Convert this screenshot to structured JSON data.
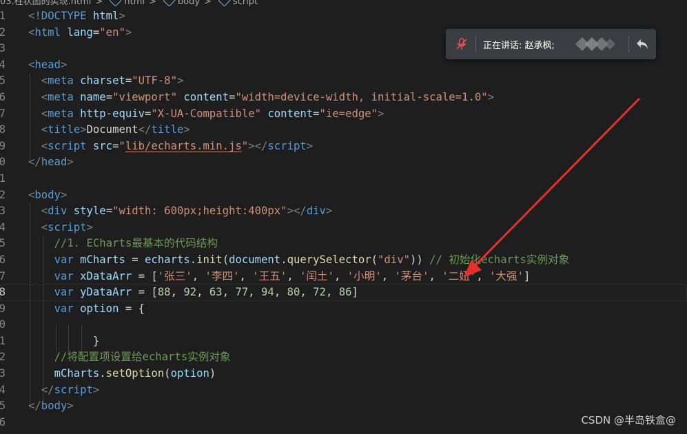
{
  "breadcrumb": {
    "file": "03.柱状图的实现.html",
    "items": [
      "html",
      "body",
      "script"
    ],
    "separator": ">"
  },
  "popup": {
    "speaking_label": "正在讲话: 赵承枫;",
    "mic_icon": "muted-mic-icon",
    "reply_icon": "reply-arrow-icon"
  },
  "watermark": "CSDN @半岛铁盒@",
  "annotation": {
    "color": "#e8302a",
    "shape": "red-arrow"
  },
  "editor": {
    "active_line": 18,
    "lines": [
      {
        "n": "1",
        "tokens": [
          [
            "pun",
            "<"
          ],
          [
            "tag",
            "!DOCTYPE"
          ],
          [
            "txt",
            " "
          ],
          [
            "attr",
            "html"
          ],
          [
            "pun",
            ">"
          ]
        ]
      },
      {
        "n": "2",
        "tokens": [
          [
            "pun",
            "<"
          ],
          [
            "tag",
            "html"
          ],
          [
            "txt",
            " "
          ],
          [
            "attr",
            "lang"
          ],
          [
            "txt",
            "="
          ],
          [
            "str",
            "\"en\""
          ],
          [
            "pun",
            ">"
          ]
        ]
      },
      {
        "n": "3",
        "tokens": []
      },
      {
        "n": "4",
        "tokens": [
          [
            "pun",
            "<"
          ],
          [
            "tag",
            "head"
          ],
          [
            "pun",
            ">"
          ]
        ]
      },
      {
        "n": "5",
        "tokens": [
          [
            "txt",
            "  "
          ],
          [
            "pun",
            "<"
          ],
          [
            "tag",
            "meta"
          ],
          [
            "txt",
            " "
          ],
          [
            "attr",
            "charset"
          ],
          [
            "txt",
            "="
          ],
          [
            "str",
            "\"UTF-8\""
          ],
          [
            "pun",
            ">"
          ]
        ]
      },
      {
        "n": "6",
        "tokens": [
          [
            "txt",
            "  "
          ],
          [
            "pun",
            "<"
          ],
          [
            "tag",
            "meta"
          ],
          [
            "txt",
            " "
          ],
          [
            "attr",
            "name"
          ],
          [
            "txt",
            "="
          ],
          [
            "str",
            "\"viewport\""
          ],
          [
            "txt",
            " "
          ],
          [
            "attr",
            "content"
          ],
          [
            "txt",
            "="
          ],
          [
            "str",
            "\"width=device-width, initial-scale=1.0\""
          ],
          [
            "pun",
            ">"
          ]
        ]
      },
      {
        "n": "7",
        "tokens": [
          [
            "txt",
            "  "
          ],
          [
            "pun",
            "<"
          ],
          [
            "tag",
            "meta"
          ],
          [
            "txt",
            " "
          ],
          [
            "attr",
            "http-equiv"
          ],
          [
            "txt",
            "="
          ],
          [
            "str",
            "\"X-UA-Compatible\""
          ],
          [
            "txt",
            " "
          ],
          [
            "attr",
            "content"
          ],
          [
            "txt",
            "="
          ],
          [
            "str",
            "\"ie=edge\""
          ],
          [
            "pun",
            ">"
          ]
        ]
      },
      {
        "n": "8",
        "tokens": [
          [
            "txt",
            "  "
          ],
          [
            "pun",
            "<"
          ],
          [
            "tag",
            "title"
          ],
          [
            "pun",
            ">"
          ],
          [
            "txt",
            "Document"
          ],
          [
            "pun",
            "</"
          ],
          [
            "tag",
            "title"
          ],
          [
            "pun",
            ">"
          ]
        ]
      },
      {
        "n": "9",
        "tokens": [
          [
            "txt",
            "  "
          ],
          [
            "pun",
            "<"
          ],
          [
            "tag",
            "script"
          ],
          [
            "txt",
            " "
          ],
          [
            "attr",
            "src"
          ],
          [
            "txt",
            "="
          ],
          [
            "str",
            "\""
          ],
          [
            "str ul",
            "lib/echarts.min.js"
          ],
          [
            "str",
            "\""
          ],
          [
            "pun",
            "></"
          ],
          [
            "tag",
            "script"
          ],
          [
            "pun",
            ">"
          ]
        ]
      },
      {
        "n": "0",
        "tokens": [
          [
            "pun",
            "</"
          ],
          [
            "tag",
            "head"
          ],
          [
            "pun",
            ">"
          ]
        ]
      },
      {
        "n": "1",
        "tokens": []
      },
      {
        "n": "2",
        "tokens": [
          [
            "pun",
            "<"
          ],
          [
            "tag",
            "body"
          ],
          [
            "pun",
            ">"
          ]
        ]
      },
      {
        "n": "3",
        "tokens": [
          [
            "txt",
            "  "
          ],
          [
            "pun",
            "<"
          ],
          [
            "tag",
            "div"
          ],
          [
            "txt",
            " "
          ],
          [
            "attr",
            "style"
          ],
          [
            "txt",
            "="
          ],
          [
            "str",
            "\"width: 600px;height:400px\""
          ],
          [
            "pun",
            "></"
          ],
          [
            "tag",
            "div"
          ],
          [
            "pun",
            ">"
          ]
        ]
      },
      {
        "n": "4",
        "tokens": [
          [
            "txt",
            "  "
          ],
          [
            "pun",
            "<"
          ],
          [
            "tag",
            "script"
          ],
          [
            "pun",
            ">"
          ]
        ]
      },
      {
        "n": "5",
        "tokens": [
          [
            "txt",
            "    "
          ],
          [
            "cmt",
            "//1. ECharts最基本的代码结构"
          ]
        ]
      },
      {
        "n": "6",
        "tokens": [
          [
            "txt",
            "    "
          ],
          [
            "kw",
            "var"
          ],
          [
            "txt",
            " "
          ],
          [
            "var",
            "mCharts"
          ],
          [
            "txt",
            " = "
          ],
          [
            "var",
            "echarts"
          ],
          [
            "txt",
            "."
          ],
          [
            "fn",
            "init"
          ],
          [
            "txt",
            "("
          ],
          [
            "var",
            "document"
          ],
          [
            "txt",
            "."
          ],
          [
            "fn",
            "querySelector"
          ],
          [
            "txt",
            "("
          ],
          [
            "str",
            "\"div\""
          ],
          [
            "txt",
            "))"
          ],
          [
            "txt",
            " "
          ],
          [
            "cmt",
            "// 初始化echarts实例对象"
          ]
        ]
      },
      {
        "n": "7",
        "tokens": [
          [
            "txt",
            "    "
          ],
          [
            "kw",
            "var"
          ],
          [
            "txt",
            " "
          ],
          [
            "var",
            "xDataArr"
          ],
          [
            "txt",
            " = ["
          ],
          [
            "str",
            "'张三'"
          ],
          [
            "txt",
            ", "
          ],
          [
            "str",
            "'李四'"
          ],
          [
            "txt",
            ", "
          ],
          [
            "str",
            "'王五'"
          ],
          [
            "txt",
            ", "
          ],
          [
            "str",
            "'闰土'"
          ],
          [
            "txt",
            ", "
          ],
          [
            "str",
            "'小明'"
          ],
          [
            "txt",
            ", "
          ],
          [
            "str",
            "'茅台'"
          ],
          [
            "txt",
            ", "
          ],
          [
            "str",
            "'二妞'"
          ],
          [
            "txt",
            ", "
          ],
          [
            "str",
            "'大强'"
          ],
          [
            "txt",
            "]"
          ]
        ]
      },
      {
        "n": "8",
        "tokens": [
          [
            "txt",
            "    "
          ],
          [
            "kw",
            "var"
          ],
          [
            "txt",
            " "
          ],
          [
            "var",
            "yDataArr"
          ],
          [
            "txt",
            " = ["
          ],
          [
            "num",
            "88"
          ],
          [
            "txt",
            ", "
          ],
          [
            "num",
            "92"
          ],
          [
            "txt",
            ", "
          ],
          [
            "num",
            "63"
          ],
          [
            "txt",
            ", "
          ],
          [
            "num",
            "77"
          ],
          [
            "txt",
            ", "
          ],
          [
            "num",
            "94"
          ],
          [
            "txt",
            ", "
          ],
          [
            "num",
            "80"
          ],
          [
            "txt",
            ", "
          ],
          [
            "num",
            "72"
          ],
          [
            "txt",
            ", "
          ],
          [
            "num",
            "86"
          ],
          [
            "txt",
            "]"
          ]
        ]
      },
      {
        "n": "9",
        "tokens": [
          [
            "txt",
            "    "
          ],
          [
            "kw",
            "var"
          ],
          [
            "txt",
            " "
          ],
          [
            "var",
            "option"
          ],
          [
            "txt",
            " = {"
          ]
        ]
      },
      {
        "n": "0",
        "tokens": []
      },
      {
        "n": "1",
        "tokens": [
          [
            "txt",
            "          }"
          ]
        ]
      },
      {
        "n": "2",
        "tokens": [
          [
            "txt",
            "    "
          ],
          [
            "cmt",
            "//将配置项设置给echarts实例对象"
          ]
        ]
      },
      {
        "n": "3",
        "tokens": [
          [
            "txt",
            "    "
          ],
          [
            "var",
            "mCharts"
          ],
          [
            "txt",
            "."
          ],
          [
            "fn",
            "setOption"
          ],
          [
            "txt",
            "("
          ],
          [
            "var",
            "option"
          ],
          [
            "txt",
            ")"
          ]
        ]
      },
      {
        "n": "4",
        "tokens": [
          [
            "txt",
            "  "
          ],
          [
            "pun",
            "</"
          ],
          [
            "tag",
            "script"
          ],
          [
            "pun",
            ">"
          ]
        ]
      },
      {
        "n": "5",
        "tokens": [
          [
            "pun",
            "</"
          ],
          [
            "tag",
            "body"
          ],
          [
            "pun",
            ">"
          ]
        ]
      },
      {
        "n": "6",
        "tokens": []
      }
    ]
  }
}
